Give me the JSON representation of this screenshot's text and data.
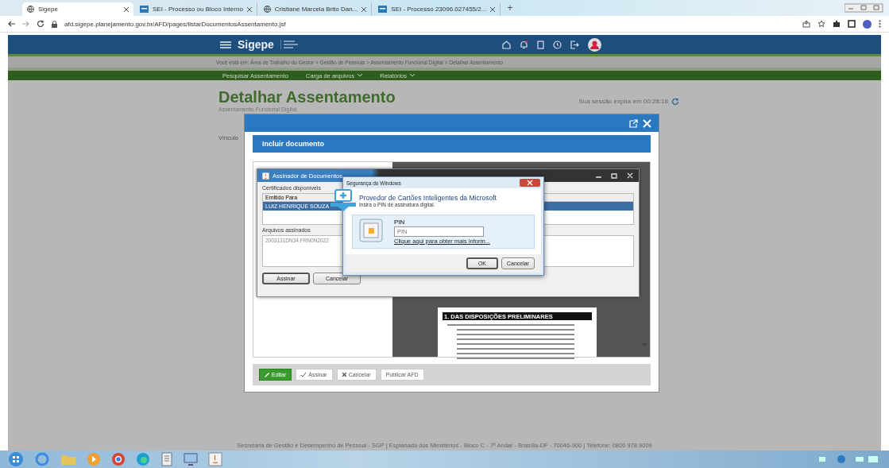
{
  "browser": {
    "tabs": [
      {
        "title": "Sigepe",
        "selected": true
      },
      {
        "title": "SEI - Processo ou Bloco Interno",
        "selected": false
      },
      {
        "title": "Cristiane Marcela Brito Dan...",
        "selected": false
      },
      {
        "title": "SEI - Processo 23096.027455/2...",
        "selected": false
      }
    ],
    "new_tab": "+",
    "url": "afd.sigepe.planejamento.gov.br/AFD/pages/listarDocumentosAssentamento.jsf"
  },
  "header": {
    "brand": "Sigepe"
  },
  "breadcrumb": "Você está em: Área de Trabalho do Gestor > Gestão de Pessoas > Assentamento Funcional Digital > Detalhar Assentamento",
  "menu": [
    {
      "label": "Pesquisar Assentamento",
      "dropdown": false
    },
    {
      "label": "Carga de arquivos",
      "dropdown": true
    },
    {
      "label": "Relatórios",
      "dropdown": true
    }
  ],
  "page": {
    "title": "Detalhar Assentamento",
    "subtitle": "Assentamento Funcional Digital",
    "session": "Sua sessão expira em 00:28:18",
    "field_label": "Vínculo"
  },
  "modal": {
    "title": "Incluir documento",
    "signer": {
      "title": "Assinador de Documentos",
      "certificates_label": "Certificados disponíveis",
      "column": "Emitido Para",
      "rows": [
        {
          "name": "LUIZ HENRIQUE SOUZA",
          "selected": true
        }
      ],
      "files_label": "Arquivos assinados",
      "files": [
        "2003131DN34 FRN0N2022"
      ],
      "buttons": [
        {
          "label": "Assinar",
          "default": true
        },
        {
          "label": "Cancelar",
          "default": false
        }
      ]
    },
    "security": {
      "title": "Segurança do Windows",
      "heading": "Provedor de Cartões Inteligentes da Microsoft",
      "instruction": "Insira o PIN de assinatura digital.",
      "pin_label": "PIN",
      "placeholder": "PIN",
      "link": "Clique aqui para obter mais inform...",
      "buttons": [
        {
          "label": "OK",
          "default": true
        },
        {
          "label": "Cancelar",
          "default": false
        }
      ]
    },
    "document_heading": "1. DAS DISPOSIÇÕES PRELIMINARES",
    "actions": [
      {
        "label": "Editar",
        "kind": "primary"
      },
      {
        "label": "Assinar",
        "kind": "default"
      },
      {
        "label": "Cancelar",
        "kind": "default"
      },
      {
        "label": "Publicar AFD",
        "kind": "default"
      }
    ]
  },
  "footer": "Secretaria de Gestão e Desempenho de Pessoal - SGP | Esplanada dos Ministérios - Bloco C - 7º Andar - Brasília-DF - 70046-900 | Telefone: 0800 978 9009"
}
